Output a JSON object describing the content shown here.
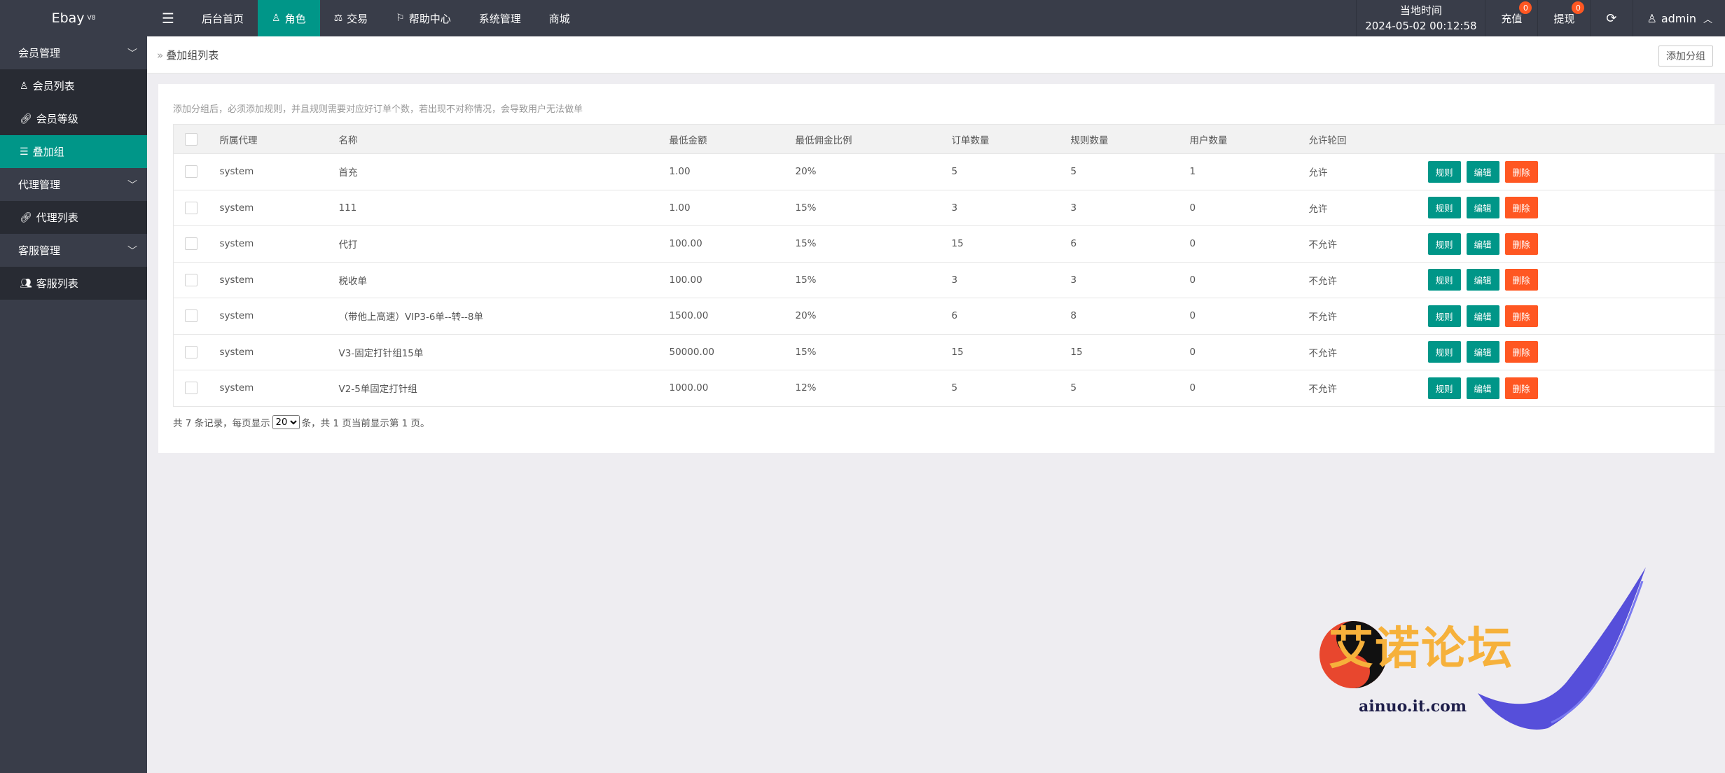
{
  "app": {
    "title": "Ebay",
    "version": "V8"
  },
  "nav": {
    "items": [
      {
        "label": "后台首页",
        "icon": ""
      },
      {
        "label": "角色",
        "icon": "user-icon",
        "active": true
      },
      {
        "label": "交易",
        "icon": "scale-icon"
      },
      {
        "label": "帮助中心",
        "icon": "flag-icon"
      },
      {
        "label": "系统管理",
        "icon": ""
      },
      {
        "label": "商城",
        "icon": ""
      }
    ]
  },
  "header": {
    "time_label": "当地时间",
    "time_value": "2024-05-02 00:12:58",
    "recharge_label": "充值",
    "recharge_badge": "0",
    "withdraw_label": "提现",
    "withdraw_badge": "0",
    "user": "admin"
  },
  "sidebar": {
    "groups": [
      {
        "label": "会员管理",
        "items": [
          {
            "label": "会员列表",
            "icon": "user-icon"
          },
          {
            "label": "会员等级",
            "icon": "link-icon"
          },
          {
            "label": "叠加组",
            "icon": "list-icon",
            "active": true
          }
        ]
      },
      {
        "label": "代理管理",
        "items": [
          {
            "label": "代理列表",
            "icon": "link-icon"
          }
        ]
      },
      {
        "label": "客服管理",
        "items": [
          {
            "label": "客服列表",
            "icon": "users-icon"
          }
        ]
      }
    ]
  },
  "page": {
    "breadcrumb": "叠加组列表",
    "add_button": "添加分组",
    "tip": "添加分组后，必须添加规则，并且规则需要对应好订单个数，若出现不对称情况，会导致用户无法做单"
  },
  "table": {
    "columns": [
      "所属代理",
      "名称",
      "最低金额",
      "最低佣金比例",
      "订单数量",
      "规则数量",
      "用户数量",
      "允许轮回"
    ],
    "actions": {
      "rule": "规则",
      "edit": "编辑",
      "delete": "删除"
    },
    "rows": [
      [
        "system",
        "首充",
        "1.00",
        "20%",
        "5",
        "5",
        "1",
        "允许"
      ],
      [
        "system",
        "111",
        "1.00",
        "15%",
        "3",
        "3",
        "0",
        "允许"
      ],
      [
        "system",
        "代打",
        "100.00",
        "15%",
        "15",
        "6",
        "0",
        "不允许"
      ],
      [
        "system",
        "税收单",
        "100.00",
        "15%",
        "3",
        "3",
        "0",
        "不允许"
      ],
      [
        "system",
        "（带他上高速）VIP3-6单--转--8单",
        "1500.00",
        "20%",
        "6",
        "8",
        "0",
        "不允许"
      ],
      [
        "system",
        "V3-固定打针组15单",
        "50000.00",
        "15%",
        "15",
        "15",
        "0",
        "不允许"
      ],
      [
        "system",
        "V2-5单固定打针组",
        "1000.00",
        "12%",
        "5",
        "5",
        "0",
        "不允许"
      ]
    ]
  },
  "pager": {
    "prefix": "共 7 条记录，每页显示",
    "page_size": "20",
    "suffix": "条，共 1 页当前显示第 1 页。"
  },
  "watermark": {
    "text": "艾诺论坛",
    "url": "ainuo.it.com"
  },
  "colors": {
    "accent": "#009688",
    "danger": "#ff5722",
    "dark": "#393d49"
  }
}
